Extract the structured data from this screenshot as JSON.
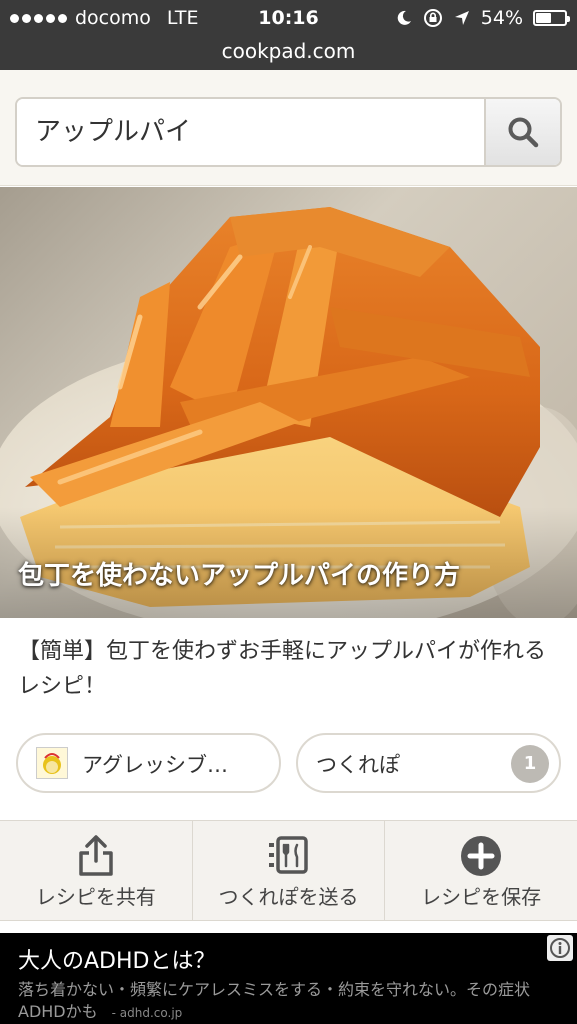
{
  "status_bar": {
    "carrier": "docomo",
    "network": "LTE",
    "time": "10:16",
    "battery_percent": "54%",
    "battery_level": 0.54
  },
  "browser": {
    "url": "cookpad.com"
  },
  "search": {
    "query": "アップルパイ",
    "button_icon": "search-icon"
  },
  "recipe": {
    "title": "包丁を使わないアップルパイの作り方",
    "description": "【簡単】包丁を使わずお手軽にアップルパイが作れるレシピ！",
    "author": "アグレッシブ…",
    "tsukurepo_label": "つくれぽ",
    "tsukurepo_count": "1"
  },
  "actions": [
    {
      "label": "レシピを共有",
      "icon": "share-icon"
    },
    {
      "label": "つくれぽを送る",
      "icon": "send-tsukurepo-icon"
    },
    {
      "label": "レシピを保存",
      "icon": "add-icon"
    }
  ],
  "ad": {
    "title": "大人のADHDとは？",
    "body": "落ち着かない・頻繁にケアレスミスをする・約束を守れない。その症状ADHDかも",
    "domain": "- adhd.co.jp"
  },
  "colors": {
    "status_bar_bg": "#3a3a3a",
    "count_badge": "#bdbab4",
    "ad_bg": "#000000"
  }
}
